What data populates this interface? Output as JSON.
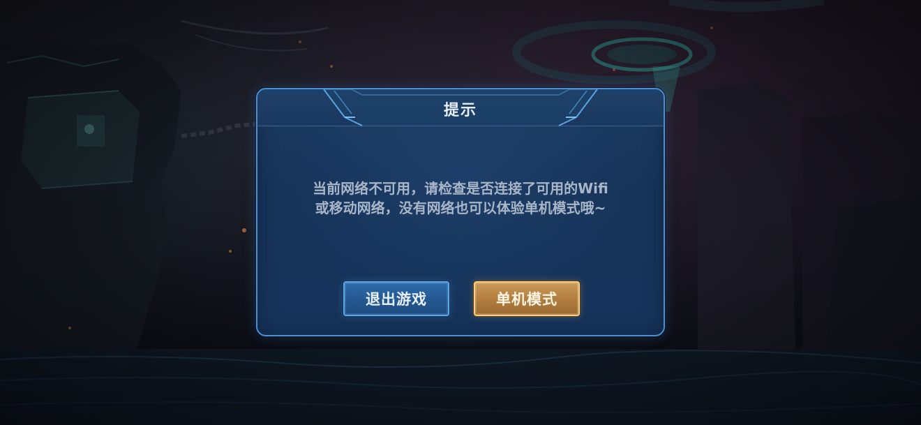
{
  "dialog": {
    "title": "提示",
    "message_lines": [
      "当前网络不可用，请检查是否连接了可用的Wifi",
      "或移动网络，没有网络也可以体验单机模式哦~"
    ],
    "buttons": {
      "exit_label": "退出游戏",
      "single_mode_label": "单机模式"
    }
  },
  "colors": {
    "dialog_border": "#4f8fd0",
    "dialog_bg": "#17345a",
    "blue_button": "#2a62a0",
    "gold_button": "#b07c3e",
    "message_text": "#a9b6c8"
  },
  "icons": [
    "header-ornament"
  ]
}
